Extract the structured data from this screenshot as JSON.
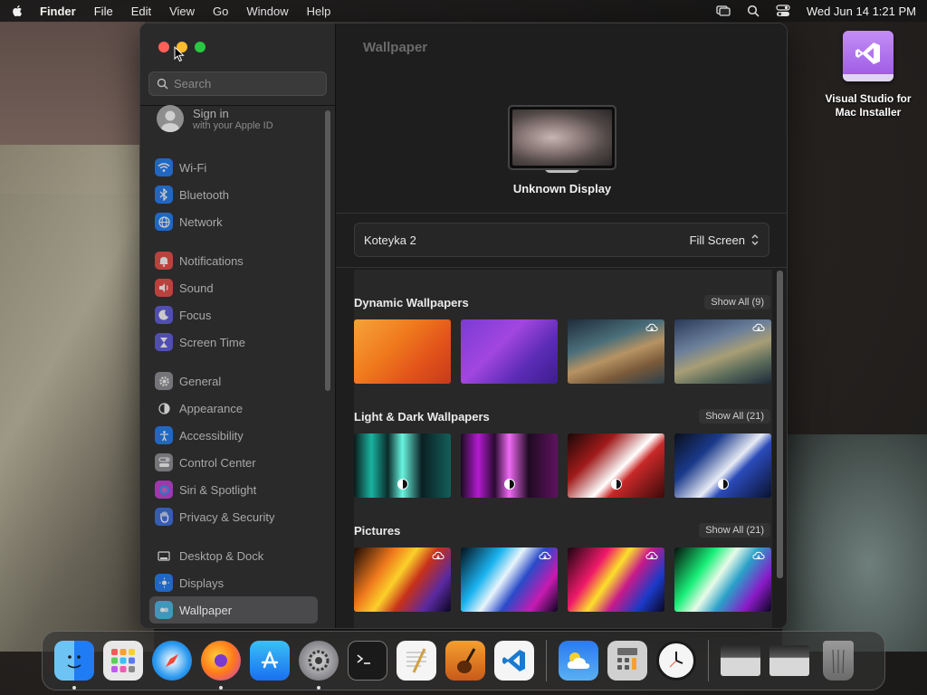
{
  "menubar": {
    "app_name": "Finder",
    "items": [
      "File",
      "Edit",
      "View",
      "Go",
      "Window",
      "Help"
    ],
    "datetime": "Wed Jun 14  1:21 PM",
    "icons": [
      "apple-icon",
      "screen-mirroring-icon",
      "spotlight-search-icon",
      "control-center-icon"
    ]
  },
  "sidebar": {
    "search_placeholder": "Search",
    "apple_id": {
      "title": "Sign in",
      "subtitle": "with your Apple ID"
    },
    "groups": [
      [
        {
          "label": "Wi-Fi",
          "icon": "wifi-icon",
          "color": "#1f7cf5"
        },
        {
          "label": "Bluetooth",
          "icon": "bluetooth-icon",
          "color": "#1f7cf5"
        },
        {
          "label": "Network",
          "icon": "globe-icon",
          "color": "#1f7cf5"
        }
      ],
      [
        {
          "label": "Notifications",
          "icon": "bell-icon",
          "color": "#ea4a43"
        },
        {
          "label": "Sound",
          "icon": "speaker-icon",
          "color": "#ea4a43"
        },
        {
          "label": "Focus",
          "icon": "moon-icon",
          "color": "#5f5ae0"
        },
        {
          "label": "Screen Time",
          "icon": "hourglass-icon",
          "color": "#5f5ae0"
        }
      ],
      [
        {
          "label": "General",
          "icon": "gear-icon",
          "color": "#8e8e93"
        },
        {
          "label": "Appearance",
          "icon": "appearance-icon",
          "color": "#2a2a2a"
        },
        {
          "label": "Accessibility",
          "icon": "accessibility-icon",
          "color": "#1f7cf5"
        },
        {
          "label": "Control Center",
          "icon": "control-center-icon",
          "color": "#8e8e93"
        },
        {
          "label": "Siri & Spotlight",
          "icon": "siri-icon",
          "color": "#c43fd6"
        },
        {
          "label": "Privacy & Security",
          "icon": "hand-icon",
          "color": "#3a6fe0"
        }
      ],
      [
        {
          "label": "Desktop & Dock",
          "icon": "dock-icon",
          "color": "#2a2a2a"
        },
        {
          "label": "Displays",
          "icon": "display-icon",
          "color": "#1f7cf5"
        },
        {
          "label": "Wallpaper",
          "icon": "wallpaper-icon",
          "color": "#3fb0e0",
          "selected": true
        }
      ]
    ]
  },
  "main": {
    "title": "Wallpaper",
    "display_name": "Unknown Display",
    "current_wallpaper": "Koteyka 2",
    "fit_option": "Fill Screen",
    "sections": [
      {
        "title": "Dynamic Wallpapers",
        "show_all": "Show All (9)",
        "thumbs": [
          {
            "name": "ventura-orange",
            "bg": "linear-gradient(135deg,#f6a33a 0%,#f07a1d 40%,#e2521b 70%,#c73a1a 100%)",
            "cloud": false,
            "dm": false
          },
          {
            "name": "monterey-purple",
            "bg": "linear-gradient(135deg,#7a3bd4 0%,#a246e0 40%,#5b2bb5 70%,#3c1e8c 100%)",
            "cloud": false,
            "dm": false
          },
          {
            "name": "catalina-coast",
            "bg": "linear-gradient(160deg,#1f2c3a 0%,#4a6e7a 35%,#b79363 55%,#7a5a3a 75%,#2b3f4a 100%)",
            "cloud": true,
            "dm": false
          },
          {
            "name": "catalina-island",
            "bg": "linear-gradient(160deg,#2a3a5a 0%,#6b7f9a 35%,#a89e76 55%,#5a6b5a 75%,#1f2a3a 100%)",
            "cloud": true,
            "dm": false
          }
        ]
      },
      {
        "title": "Light & Dark Wallpapers",
        "show_all": "Show All (21)",
        "thumbs": [
          {
            "name": "macbook-green",
            "bg": "linear-gradient(90deg,#0b1a1a 0%,#1ab3a0 18%,#0a2a2a 35%,#6af5e0 50%,#0a1f22 70%,#135f5a 100%)",
            "cloud": false,
            "dm": true
          },
          {
            "name": "macbook-purple",
            "bg": "linear-gradient(90deg,#1a0b1f 0%,#b31ad0 18%,#2a0a30 35%,#f06af5 50%,#1f0a22 70%,#5f135f 100%)",
            "cloud": false,
            "dm": true
          },
          {
            "name": "red-waves",
            "bg": "linear-gradient(135deg,#1a0808 0%,#a01a1a 30%,#ffffff 55%,#c82828 65%,#3a0a0a 100%)",
            "cloud": false,
            "dm": true
          },
          {
            "name": "blue-waves",
            "bg": "linear-gradient(135deg,#0a0f1a 0%,#1a3a8a 30%,#e8ecf5 55%,#2a4ab8 65%,#0a1230 100%)",
            "cloud": false,
            "dm": true
          }
        ]
      },
      {
        "title": "Pictures",
        "show_all": "Show All (21)",
        "thumbs": [
          {
            "name": "swirl-orange",
            "bg": "linear-gradient(125deg,#1a0a05 0%,#f07a1d 30%,#fbd02a 45%,#c7301a 60%,#5a2aa0 80%,#0a0520 100%)",
            "cloud": true,
            "dm": false
          },
          {
            "name": "swirl-blue",
            "bg": "linear-gradient(125deg,#05101a 0%,#1ab3f0 30%,#e8f5fb 45%,#2a4ac8 60%,#c71ab0 80%,#0a0520 100%)",
            "cloud": true,
            "dm": false
          },
          {
            "name": "swirl-pink",
            "bg": "linear-gradient(125deg,#1a0510 0%,#f01a6a 30%,#fbe02a 45%,#c71a8a 60%,#1a3ac8 80%,#0a0520 100%)",
            "cloud": true,
            "dm": false
          },
          {
            "name": "swirl-green",
            "bg": "linear-gradient(125deg,#05100a 0%,#1af07a 30%,#e8fbe8 45%,#2aa0c8 60%,#8a1ac7 80%,#0a0520 100%)",
            "cloud": true,
            "dm": false
          }
        ]
      }
    ]
  },
  "desktop": {
    "icon_label_1": "Visual Studio for",
    "icon_label_2": "Mac Installer"
  },
  "dock": {
    "apps": [
      {
        "name": "finder",
        "icon": "finder-icon",
        "running": true
      },
      {
        "name": "launchpad",
        "icon": "launchpad-icon",
        "running": false
      },
      {
        "name": "safari",
        "icon": "safari-icon",
        "running": false
      },
      {
        "name": "firefox",
        "icon": "firefox-icon",
        "running": true
      },
      {
        "name": "app-store",
        "icon": "app-store-icon",
        "running": false
      },
      {
        "name": "system-settings",
        "icon": "settings-icon",
        "running": true
      },
      {
        "name": "terminal",
        "icon": "terminal-icon",
        "running": false
      },
      {
        "name": "textedit",
        "icon": "textedit-icon",
        "running": false
      },
      {
        "name": "garageband",
        "icon": "garageband-icon",
        "running": false
      },
      {
        "name": "vscode",
        "icon": "vscode-icon",
        "running": false
      }
    ],
    "apps2": [
      {
        "name": "weather",
        "icon": "weather-icon",
        "running": false
      },
      {
        "name": "calculator",
        "icon": "calculator-icon",
        "running": false
      },
      {
        "name": "clock",
        "icon": "clock-icon",
        "running": false
      }
    ],
    "others": [
      {
        "name": "recent-window-1",
        "icon": "window-thumbnail-icon"
      },
      {
        "name": "recent-window-2",
        "icon": "window-thumbnail-icon"
      },
      {
        "name": "trash",
        "icon": "trash-icon"
      }
    ]
  }
}
